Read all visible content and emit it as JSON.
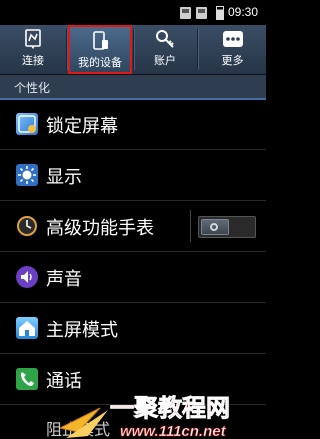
{
  "status_bar": {
    "time": "09:30"
  },
  "tabs": [
    {
      "label": "连接",
      "icon": "connections-icon",
      "selected": false
    },
    {
      "label": "我的设备",
      "icon": "my-device-icon",
      "selected": true
    },
    {
      "label": "账户",
      "icon": "accounts-icon",
      "selected": false
    },
    {
      "label": "更多",
      "icon": "more-icon",
      "selected": false
    }
  ],
  "section": {
    "title": "个性化"
  },
  "items": [
    {
      "label": "锁定屏幕",
      "icon": "lock-screen-icon"
    },
    {
      "label": "显示",
      "icon": "display-icon"
    },
    {
      "label": "高级功能手表",
      "icon": "watch-icon",
      "toggle": false
    },
    {
      "label": "声音",
      "icon": "sound-icon"
    },
    {
      "label": "主屏模式",
      "icon": "home-screen-icon"
    },
    {
      "label": "通话",
      "icon": "call-icon"
    },
    {
      "label": "阻止模式",
      "icon": "blocking-mode-icon"
    }
  ],
  "watermark": {
    "text": "一聚教程网",
    "url": "www.111cn.net"
  },
  "colors": {
    "tab_bar": "#2e3f55",
    "selected_outline": "#e01818",
    "section_bg": "#2e3d50",
    "accent_line": "#3f6fa3"
  }
}
